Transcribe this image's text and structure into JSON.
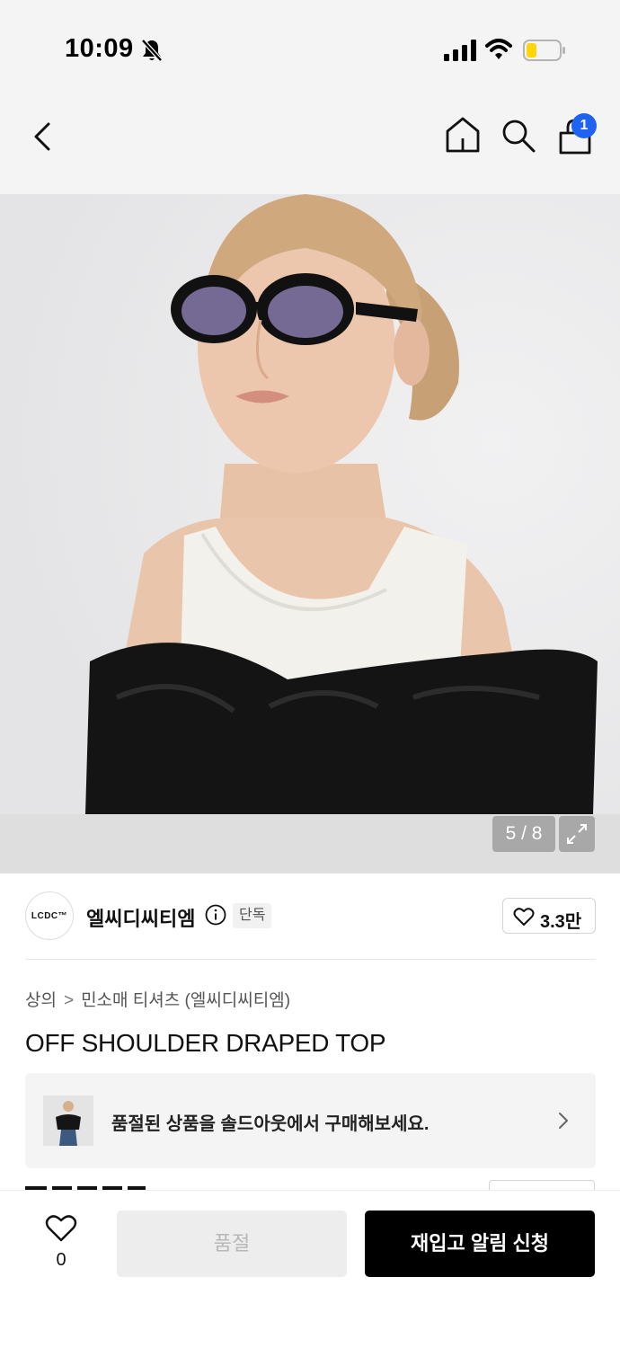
{
  "status_bar": {
    "time": "10:09"
  },
  "nav": {
    "cart_count": "1"
  },
  "gallery": {
    "counter": "5 / 8"
  },
  "brand": {
    "logo_text": "LCDC™",
    "name": "엘씨디씨티엠",
    "badge": "단독",
    "likes": "3.3만"
  },
  "breadcrumb": {
    "category": "상의",
    "separator": ">",
    "subcategory": "민소매 티셔츠 (엘씨디씨티엠)"
  },
  "product": {
    "title": "OFF SHOULDER DRAPED TOP"
  },
  "soldout_banner": {
    "text": "품절된 상품을 솔드아웃에서 구매해보세요."
  },
  "bottom_bar": {
    "wish_count": "0",
    "soldout_label": "품절",
    "restock_label": "재입고 알림 신청"
  },
  "colors": {
    "accent_blue": "#1e63f2",
    "primary_button": "#000000",
    "disabled_button": "#ededed"
  },
  "icons": [
    "bell-off-icon",
    "signal-icon",
    "wifi-icon",
    "battery-icon",
    "back-icon",
    "home-icon",
    "search-icon",
    "cart-icon",
    "expand-icon",
    "info-icon",
    "heart-icon",
    "chevron-right-icon"
  ]
}
